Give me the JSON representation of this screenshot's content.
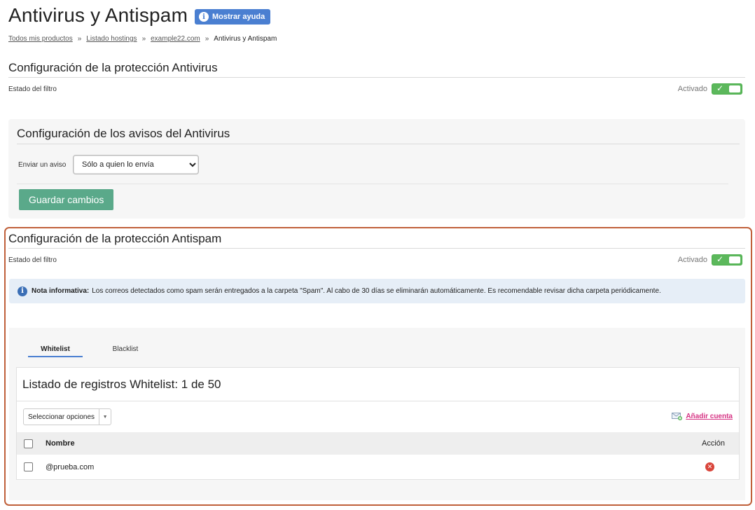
{
  "header": {
    "title": "Antivirus y Antispam",
    "help_label": "Mostrar ayuda"
  },
  "breadcrumb": {
    "items": [
      "Todos mis productos",
      "Listado hostings",
      "example22.com"
    ],
    "separator": "»",
    "current": "Antivirus y Antispam"
  },
  "antivirus": {
    "title": "Configuración de la protección Antivirus",
    "filter_label": "Estado del filtro",
    "state_label": "Activado",
    "notices": {
      "title": "Configuración de los avisos del Antivirus",
      "send_label": "Enviar un aviso",
      "selected": "Sólo a quien lo envía",
      "save_label": "Guardar cambios"
    }
  },
  "antispam": {
    "title": "Configuración de la protección Antispam",
    "filter_label": "Estado del filtro",
    "state_label": "Activado",
    "note_title": "Nota informativa:",
    "note_text": "Los correos detectados como spam serán entregados a la carpeta \"Spam\". Al cabo de 30 días se eliminarán automáticamente. Es recomendable revisar dicha carpeta periódicamente.",
    "tabs": [
      "Whitelist",
      "Blacklist"
    ],
    "list": {
      "title": "Listado de registros Whitelist: 1 de 50",
      "options_label": "Seleccionar opciones",
      "add_label": "Añadir cuenta",
      "col_name": "Nombre",
      "col_action": "Acción",
      "rows": [
        {
          "name": "@prueba.com"
        }
      ]
    }
  },
  "colors": {
    "accent_blue": "#4a7fd1",
    "toggle_green": "#5cb85c",
    "save_green": "#5aa98a",
    "add_link_pink": "#d63384",
    "highlight_border": "#c0603a",
    "delete_red": "#d9453b"
  }
}
